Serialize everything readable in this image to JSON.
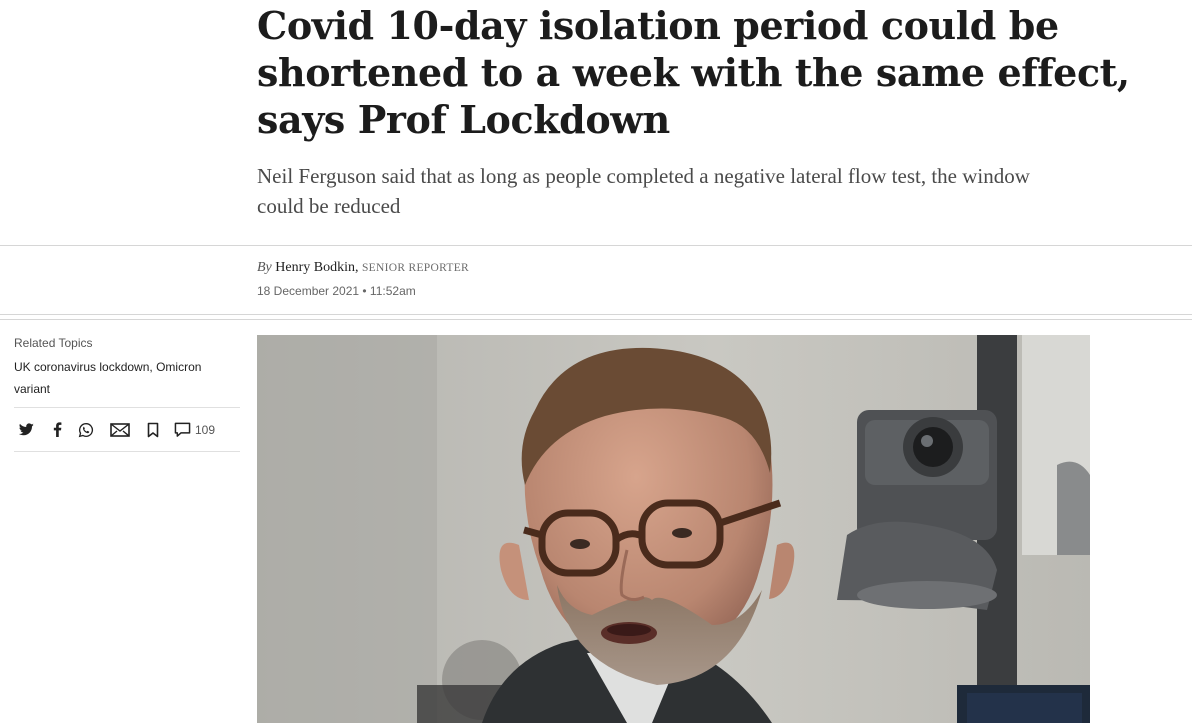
{
  "article": {
    "headline": "Covid 10-day isolation period could be shortened to a week with the same effect, says Prof Lockdown",
    "standfirst": "Neil Ferguson said that as long as people completed a negative lateral flow test, the window could be reduced",
    "byline": {
      "prefix": "By",
      "author": "Henry Bodkin,",
      "role": "SENIOR REPORTER"
    },
    "date": "18 December 2021 • 11:52am"
  },
  "sidebar": {
    "related_label": "Related Topics",
    "related_links": [
      "UK coronavirus lockdown",
      "Omicron variant"
    ],
    "share": {
      "icons": [
        "twitter-icon",
        "facebook-icon",
        "whatsapp-icon",
        "email-icon",
        "bookmark-icon",
        "comment-icon"
      ],
      "comment_count": "109"
    }
  },
  "hero_image": {
    "subject": "man-with-glasses-speaking"
  },
  "colors": {
    "text": "#1c1c1c",
    "muted": "#666666",
    "rule": "#d6d6d6"
  }
}
